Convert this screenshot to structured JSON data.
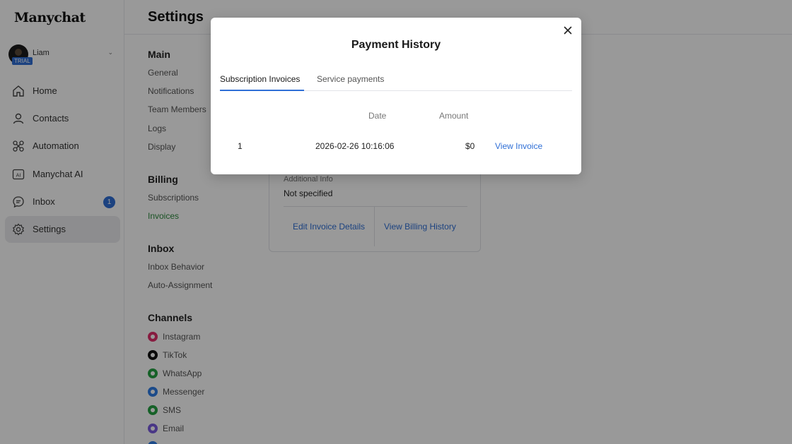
{
  "nav": {
    "logo": "Manychat",
    "account": {
      "name": "Liam",
      "badge": "TRIAL"
    },
    "items": [
      {
        "label": "Home",
        "icon": "home-icon"
      },
      {
        "label": "Contacts",
        "icon": "user-icon"
      },
      {
        "label": "Automation",
        "icon": "automation-icon"
      },
      {
        "label": "Manychat AI",
        "icon": "ai-icon"
      },
      {
        "label": "Inbox",
        "icon": "inbox-icon",
        "badge": "1"
      },
      {
        "label": "Settings",
        "icon": "gear-icon"
      }
    ]
  },
  "settings": {
    "title": "Settings",
    "main": {
      "heading": "Main",
      "links": [
        "General",
        "Notifications",
        "Team Members",
        "Logs",
        "Display"
      ]
    },
    "billing": {
      "heading": "Billing",
      "links": [
        "Subscriptions",
        "Invoices"
      ]
    },
    "inbox": {
      "heading": "Inbox",
      "links": [
        "Inbox Behavior",
        "Auto-Assignment"
      ]
    },
    "channels": {
      "heading": "Channels",
      "items": [
        {
          "label": "Instagram",
          "color": "#e1306c"
        },
        {
          "label": "TikTok",
          "color": "#111111"
        },
        {
          "label": "WhatsApp",
          "color": "#25a244"
        },
        {
          "label": "Messenger",
          "color": "#2f7ee6"
        },
        {
          "label": "SMS",
          "color": "#25a244"
        },
        {
          "label": "Email",
          "color": "#7b5ce0"
        }
      ]
    }
  },
  "billing_card": {
    "additional_info_label": "Additional Info",
    "additional_info_value": "Not specified",
    "edit_invoice_details": "Edit Invoice Details",
    "view_billing_history": "View Billing History"
  },
  "modal": {
    "title": "Payment History",
    "tabs": [
      "Subscription Invoices",
      "Service payments"
    ],
    "columns": {
      "date": "Date",
      "amount": "Amount"
    },
    "rows": [
      {
        "index": "1",
        "date": "2026-02-26 10:16:06",
        "amount": "$0",
        "action": "View Invoice"
      }
    ]
  },
  "colors": {
    "accent": "#2f6fd6",
    "active_link": "#2e8b3e"
  }
}
